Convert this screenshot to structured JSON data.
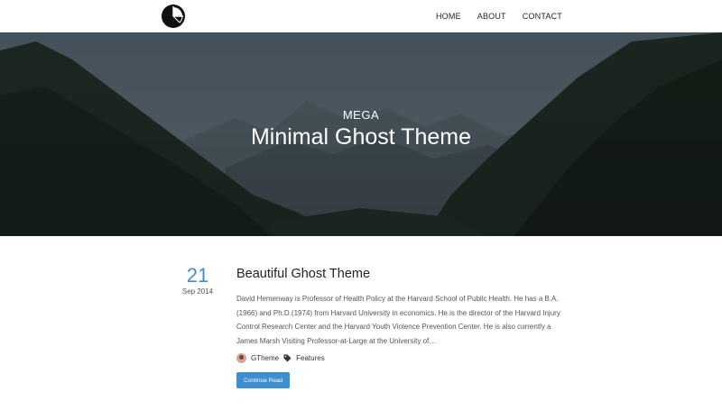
{
  "header": {
    "logo_icon": "pie-chart-logo-icon",
    "nav": [
      {
        "label": "HOME"
      },
      {
        "label": "ABOUT"
      },
      {
        "label": "CONTACT"
      }
    ]
  },
  "hero": {
    "kicker": "MEGA",
    "title": "Minimal Ghost Theme",
    "background": "mountain-forest-photo"
  },
  "post": {
    "date_day": "21",
    "date_month": "Sep 2014",
    "title": "Beautiful Ghost Theme",
    "excerpt": "David Hemenway is Professor of Health Policy at the Harvard School of Public Health. He has a B.A. (1966) and Ph.D.(1974) from Harvard University in economics. He is the director of the Harvard Injury Control Research Center and the Harvard Youth Violence Prevention Center. He is also currently a James Marsh Visiting Professor-at-Large at the University of…",
    "author": "GTheme",
    "tag_icon": "tag-icon",
    "tag": "Features",
    "read_more_label": "Continue Read"
  },
  "colors": {
    "accent": "#3d8fd1",
    "text": "#333333"
  }
}
